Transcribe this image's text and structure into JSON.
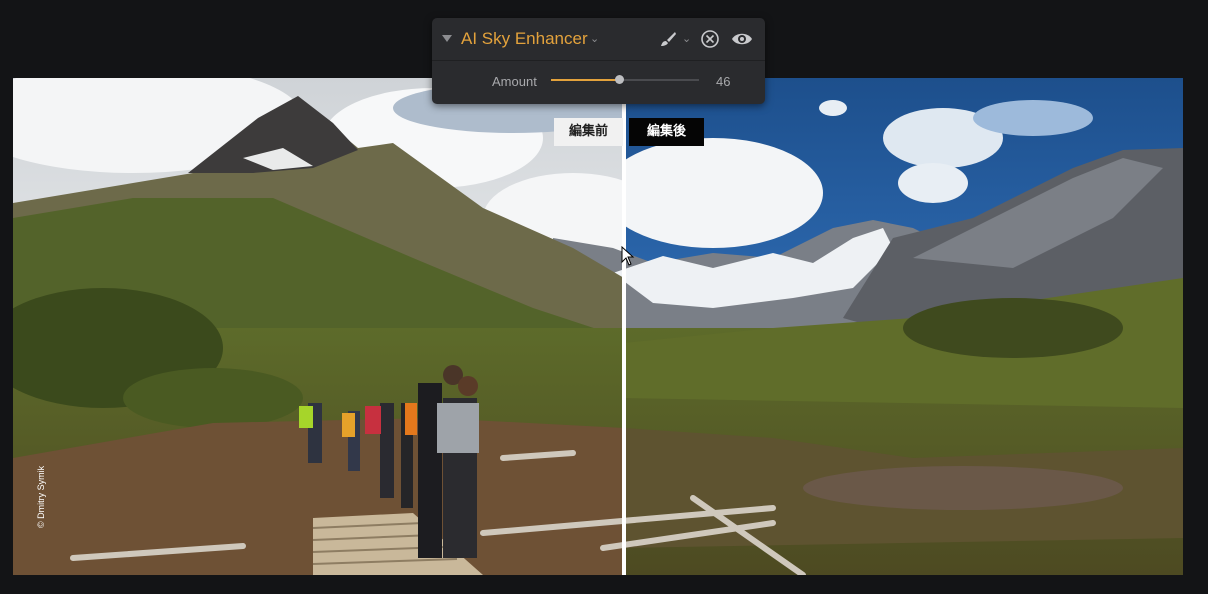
{
  "panel": {
    "title": "AI Sky Enhancer",
    "slider": {
      "label": "Amount",
      "value": 46,
      "min": 0,
      "max": 100
    },
    "icons": {
      "collapse": "triangle-down-icon",
      "title_menu": "chevron-down-icon",
      "brush": "brush-icon",
      "brush_menu": "chevron-down-icon",
      "reset": "close-circle-icon",
      "visibility": "eye-icon"
    },
    "accent_color": "#e3a23c"
  },
  "compare": {
    "before_label": "編集前",
    "after_label": "編集後"
  },
  "photo": {
    "credit": "© Dmitry Symik"
  }
}
